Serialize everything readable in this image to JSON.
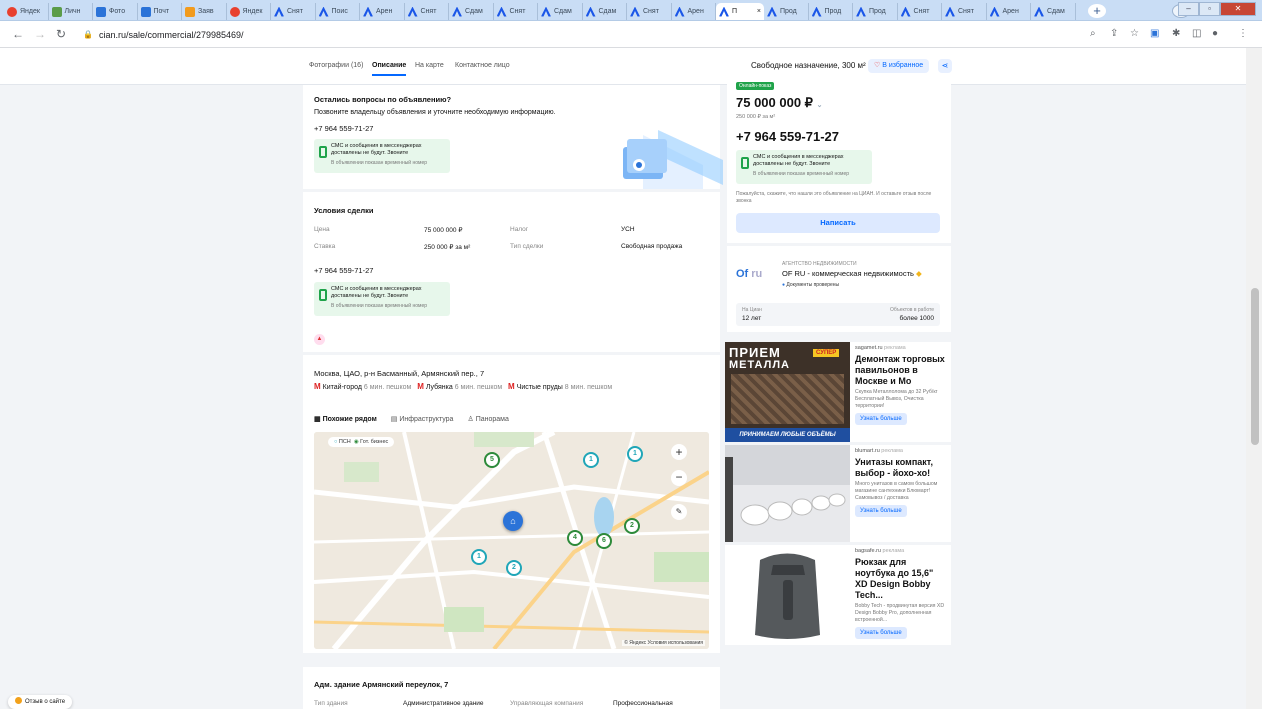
{
  "browser": {
    "tabs": [
      "Яндек",
      "Личн",
      "Фото",
      "Почт",
      "Заяв",
      "Яндек",
      "Снят",
      "Поис",
      "Арен",
      "Снят",
      "Сдам",
      "Снят",
      "Сдам",
      "Сдам",
      "Снят",
      "Арен",
      "П",
      "Прод",
      "Прод",
      "Прод",
      "Снят",
      "Снят",
      "Арен",
      "Сдам"
    ],
    "active_tab_close": "×",
    "url": "cian.ru/sale/commercial/279985469/"
  },
  "subnav": {
    "items": [
      "Фотографии (16)",
      "Описание",
      "На карте",
      "Контактное лицо"
    ],
    "title": "Свободное назначение, 300 м²",
    "fav": "В избранное"
  },
  "contact": {
    "heading": "Остались вопросы по объявлению?",
    "text": "Позвоните владельцу объявления и уточните необходимую информацию.",
    "phone": "+7 964 559-71-27",
    "sms_title": "СМС и сообщения в мессенджерах доставлены не будут. Звоните",
    "sms_note": "В объявлении показан временный номер"
  },
  "deal": {
    "heading": "Условия сделки",
    "rows": [
      {
        "l1": "Цена",
        "v1": "75 000 000 ₽",
        "l2": "Налог",
        "v2": "УСН"
      },
      {
        "l1": "Ставка",
        "v1": "250 000 ₽ за м²",
        "l2": "Тип сделки",
        "v2": "Свободная продажа"
      }
    ],
    "phone": "+7 964 559-71-27"
  },
  "location": {
    "address": "Москва, ЦАО, р-н Басманный, Армянский пер., 7",
    "metro": [
      {
        "name": "Китай-город",
        "time": "6 мин. пешком"
      },
      {
        "name": "Лубянка",
        "time": "6 мин. пешком"
      },
      {
        "name": "Чистые пруды",
        "time": "8 мин. пешком"
      }
    ],
    "map_tabs": [
      "Похожие рядом",
      "Инфраструктура",
      "Панорама"
    ],
    "legend": [
      "ПСН",
      "Гот. бизнес"
    ],
    "pins": [
      "5",
      "1",
      "1",
      "2",
      "4",
      "6",
      "1",
      "2"
    ],
    "copyright": "© Яндекс Условия использования"
  },
  "building": {
    "heading": "Адм. здание Армянский переулок, 7",
    "labels": [
      "Тип здания",
      "Административное здание",
      "Управляющая компания",
      "Профессиональная"
    ]
  },
  "side": {
    "badge": "Онлайн-показ",
    "price": "75 000 000 ₽",
    "per": "250 000 ₽ за м²",
    "phone": "+7 964 559-71-27",
    "sms_title": "СМС и сообщения в мессенджерах доставлены не будут. Звоните",
    "sms_note": "В объявлении показан временный номер",
    "hint": "Пожалуйста, скажите, что нашли это объявление на ЦИАН. И оставьте отзыв после звонка",
    "write": "Написать",
    "agency_label": "АГЕНТСТВО НЕДВИЖИМОСТИ",
    "agency_name": "OF RU - коммерческая недвижимость",
    "agency_docs": "Документы проверены",
    "stat1_l": "На Циан",
    "stat1_v": "12 лет",
    "stat2_l": "Объектов в работе",
    "stat2_v": "более 1000"
  },
  "ads": [
    {
      "site": "sagamet.ru",
      "title": "Демонтаж торговых павильонов в Москве и Мо",
      "desc": "Скупка Металлолома до 32 Руб/кг Бесплатный Вывоз, Очистка территории!",
      "btn": "Узнать больше",
      "img_text_1": "ПРИЕМ",
      "img_text_2": "МЕТАЛЛА",
      "img_badge": "СУПЕР",
      "img_text_3": "ПРИНИМАЕМ ЛЮБЫЕ ОБЪЁМЫ"
    },
    {
      "site": "blumart.ru",
      "title": "Унитазы компакт, выбор - йохо-хо!",
      "desc": "Много унитазов в самом большом магазине сантехники Блюмарт! Самовывоз / доставка",
      "btn": "Узнать больше"
    },
    {
      "site": "bagsafe.ru",
      "title": "Рюкзак для ноутбука до 15,6\" XD Design Bobby Tech...",
      "desc": "Bobby Tech - продвинутая версия XD Design Bobby Pro, дополненная встроенной...",
      "btn": "Узнать больше"
    }
  ],
  "ad_label": "реклама",
  "feedback": "Отзыв о сайте"
}
